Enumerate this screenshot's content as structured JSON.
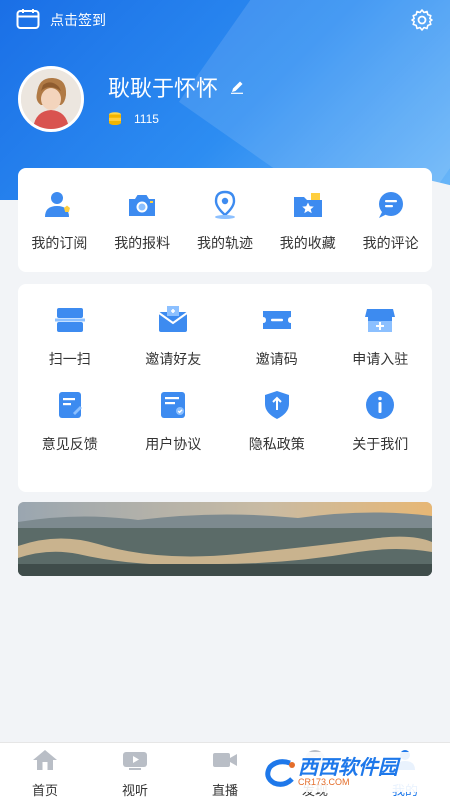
{
  "header": {
    "checkin_label": "点击签到",
    "username": "耿耿于怀怀",
    "coin_count": "1115"
  },
  "quick_actions": [
    {
      "label": "我的订阅",
      "icon": "subscribe-icon"
    },
    {
      "label": "我的报料",
      "icon": "camera-icon"
    },
    {
      "label": "我的轨迹",
      "icon": "location-pin-icon"
    },
    {
      "label": "我的收藏",
      "icon": "star-folder-icon"
    },
    {
      "label": "我的评论",
      "icon": "comment-bubble-icon"
    }
  ],
  "services": [
    {
      "label": "扫一扫",
      "icon": "scan-icon"
    },
    {
      "label": "邀请好友",
      "icon": "invite-mail-icon"
    },
    {
      "label": "邀请码",
      "icon": "ticket-icon"
    },
    {
      "label": "申请入驻",
      "icon": "store-add-icon"
    },
    {
      "label": "意见反馈",
      "icon": "feedback-icon"
    },
    {
      "label": "用户协议",
      "icon": "agreement-icon"
    },
    {
      "label": "隐私政策",
      "icon": "shield-icon"
    },
    {
      "label": "关于我们",
      "icon": "info-icon"
    }
  ],
  "tabbar": [
    {
      "label": "首页",
      "icon": "home-icon"
    },
    {
      "label": "视听",
      "icon": "tv-icon"
    },
    {
      "label": "直播",
      "icon": "video-camera-icon"
    },
    {
      "label": "发现",
      "icon": "discover-icon"
    },
    {
      "label": "我的",
      "icon": "profile-icon",
      "active": true
    }
  ],
  "watermark": {
    "text": "西西软件园",
    "sub": "CR173.COM"
  },
  "colors": {
    "accent": "#1e78ea",
    "icon_blue": "#3d8bf0",
    "icon_yellow": "#ffce3d"
  }
}
